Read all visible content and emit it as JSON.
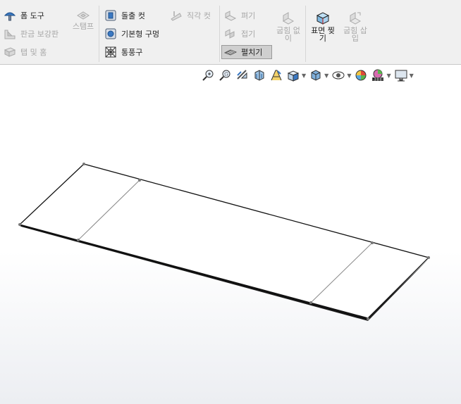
{
  "ribbon": {
    "foam_tool": "폼 도구",
    "gusset": "판금 보강판",
    "tab_slot": "탭 및 홈",
    "stamp": "스탬프",
    "extruded_cut": "돌출 컷",
    "simple_hole": "기본형 구멍",
    "vent": "통풍구",
    "normal_cut": "직각 컷",
    "unfold": "펴기",
    "fold": "접기",
    "no_bends": "굽힘 없\n이",
    "flatten": "펼치기",
    "rip": "표면 찢\n기",
    "insert_bends": "굽힘 삽\n입"
  },
  "view_toolbar": {
    "icons": [
      "zoom-to-fit-icon",
      "zoom-to-area-icon",
      "previous-view-icon",
      "section-view-icon",
      "dynamic-annotation-icon",
      "view-orientation-icon",
      "display-style-icon",
      "hide-show-items-icon",
      "edit-appearance-icon",
      "apply-scene-icon",
      "view-settings-icon"
    ]
  }
}
